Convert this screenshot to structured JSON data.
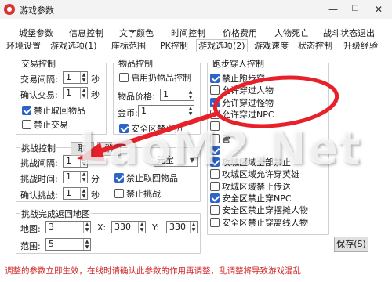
{
  "window": {
    "title": "游戏参数",
    "icon": "game-app-icon",
    "min": "—",
    "max": "☐",
    "close": "✕"
  },
  "tabs_row1": [
    "城堡参数",
    "信息控制",
    "文字颜色",
    "时间控制",
    "价格费用",
    "人物死亡",
    "战斗状态退出"
  ],
  "tabs_row2": [
    "环境设置",
    "游戏选项(1)",
    "座标范围",
    "PK控制",
    "游戏选项(2)",
    "游戏速度",
    "状态控制",
    "升级经验"
  ],
  "active_tab": "游戏选项(2)",
  "trade": {
    "title": "交易控制",
    "interval_label": "交易间隔:",
    "interval_value": "1",
    "interval_unit": "秒",
    "confirm_label": "确认交易:",
    "confirm_value": "1",
    "confirm_unit": "秒",
    "cb_no_take": "禁止取回物品",
    "cb_no_take_checked": true,
    "cb_no_trade": "禁止交易",
    "cb_no_trade_checked": false
  },
  "item": {
    "title": "物品控制",
    "cb_enable": "启用扔物品控制",
    "cb_enable_checked": false,
    "price_label": "物品价格:",
    "price_value": "1",
    "gold_label": "金币:",
    "gold_value": "1",
    "cb_safe": "安全区禁止扔",
    "cb_safe_checked": true
  },
  "challenge": {
    "title": "挑战控制",
    "interval_label": "挑战间隔:",
    "interval_value": "1",
    "time_label": "挑战时间:",
    "time_value": "1",
    "time_unit": "分",
    "confirm_label": "确认挑战:",
    "confirm_value": "1",
    "confirm_unit": "秒",
    "btn_ok": "取",
    "btn_cancel": "消",
    "currency_value": "元宝",
    "cb_no_take": "禁止取回物品",
    "cb_no_take_checked": true,
    "cb_no_challenge": "禁止挑战",
    "cb_no_challenge_checked": false
  },
  "returnmap": {
    "title": "挑战完成返回地图",
    "map_label": "地图:",
    "map_value": "3",
    "x_label": "X:",
    "x_value": "330",
    "y_label": "Y:",
    "y_value": "330",
    "range_label": "范围:",
    "range_value": "5"
  },
  "walk": {
    "title": "跑步穿人控制",
    "items": [
      {
        "label": "禁止跑步穿",
        "checked": true
      },
      {
        "label": "允许穿过人物",
        "checked": false
      },
      {
        "label": "允许穿过怪物",
        "checked": true
      },
      {
        "label": "允许穿过NPC",
        "checked": false
      },
      {
        "label": "",
        "checked": false
      },
      {
        "label": "管",
        "checked": false
      },
      {
        "label": "",
        "checked": true
      },
      {
        "label": "攻城区域全部禁止",
        "checked": true
      },
      {
        "label": "攻城区域允许穿英雄",
        "checked": false
      },
      {
        "label": "攻城区域禁止传送",
        "checked": false
      },
      {
        "label": "安全区禁止穿NPC",
        "checked": true
      },
      {
        "label": "安全区禁止穿摆摊人物",
        "checked": false
      },
      {
        "label": "安全区禁止穿离线人物",
        "checked": false
      }
    ]
  },
  "save_label": "保存(S)",
  "status_text": "调整的参数立即生效，在线时请确认此参数的作用再调整，乱调整将导致游戏混乱",
  "watermark": "LaoM2.Net",
  "colors": {
    "accent": "#2d64c8",
    "status_red": "#d02a2a",
    "annotation_red": "#e8202a"
  }
}
